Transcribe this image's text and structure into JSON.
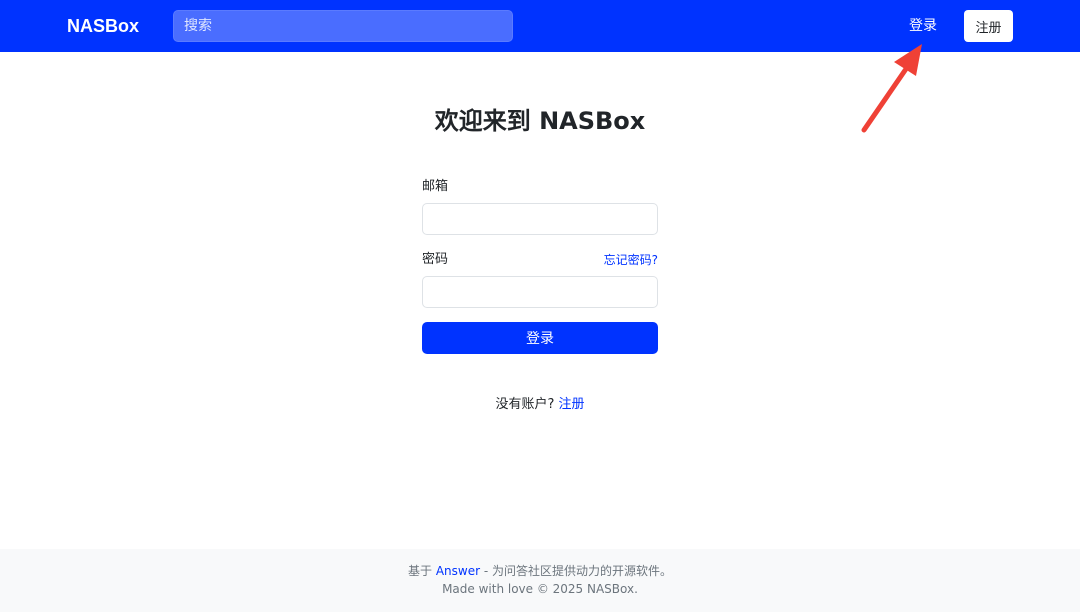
{
  "navbar": {
    "brand": "NASBox",
    "search_placeholder": "搜索",
    "login_label": "登录",
    "register_label": "注册",
    "background": "#0033ff"
  },
  "main": {
    "title": "欢迎来到 NASBox",
    "email_label": "邮箱",
    "email_value": "",
    "password_label": "密码",
    "password_value": "",
    "forgot_link": "忘记密码?",
    "login_button": "登录",
    "no_account_text": "没有账户?",
    "register_link": "注册"
  },
  "footer": {
    "prefix": "基于",
    "answer_link": "Answer",
    "suffix": " - 为问答社区提供动力的开源软件。",
    "made_with": "Made with love © 2025 NASBox."
  },
  "colors": {
    "accent": "#0033ff",
    "annotation_arrow": "#ef4136"
  }
}
